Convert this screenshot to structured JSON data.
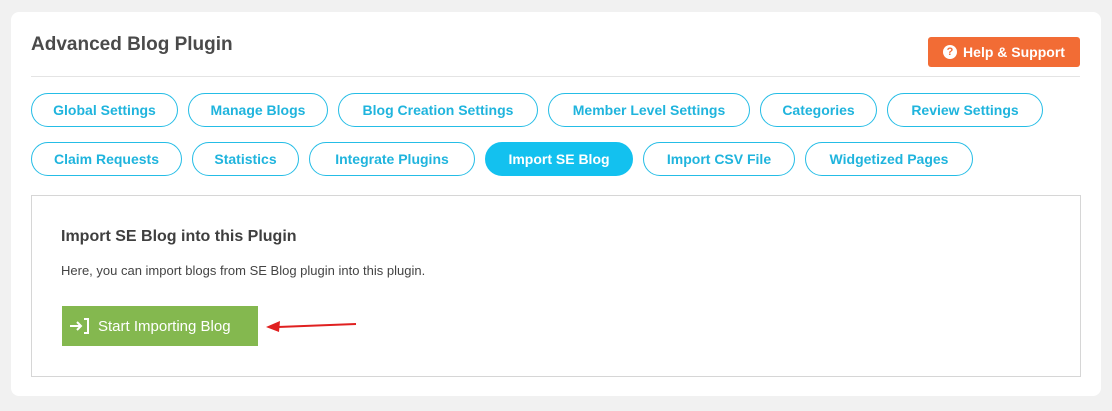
{
  "header": {
    "title": "Advanced Blog Plugin",
    "help_label": "Help & Support"
  },
  "tabs_row1": [
    {
      "label": "Global Settings",
      "active": false
    },
    {
      "label": "Manage Blogs",
      "active": false
    },
    {
      "label": "Blog Creation Settings",
      "active": false
    },
    {
      "label": "Member Level Settings",
      "active": false
    },
    {
      "label": "Categories",
      "active": false
    },
    {
      "label": "Review Settings",
      "active": false
    }
  ],
  "tabs_row2": [
    {
      "label": "Claim Requests",
      "active": false
    },
    {
      "label": "Statistics",
      "active": false
    },
    {
      "label": "Integrate Plugins",
      "active": false
    },
    {
      "label": "Import SE Blog",
      "active": true
    },
    {
      "label": "Import CSV File",
      "active": false
    },
    {
      "label": "Widgetized Pages",
      "active": false
    }
  ],
  "panel": {
    "heading": "Import SE Blog into this Plugin",
    "description": "Here, you can import blogs from SE Blog plugin into this plugin.",
    "import_button_label": "Start Importing Blog"
  },
  "colors": {
    "accent": "#13c1ef",
    "help_button": "#f26c35",
    "import_button": "#84b84f",
    "annotation_arrow": "#e02020"
  },
  "icons": {
    "help": "question-circle-icon",
    "import": "sign-in-icon",
    "annotation": "red-arrow-annotation"
  }
}
